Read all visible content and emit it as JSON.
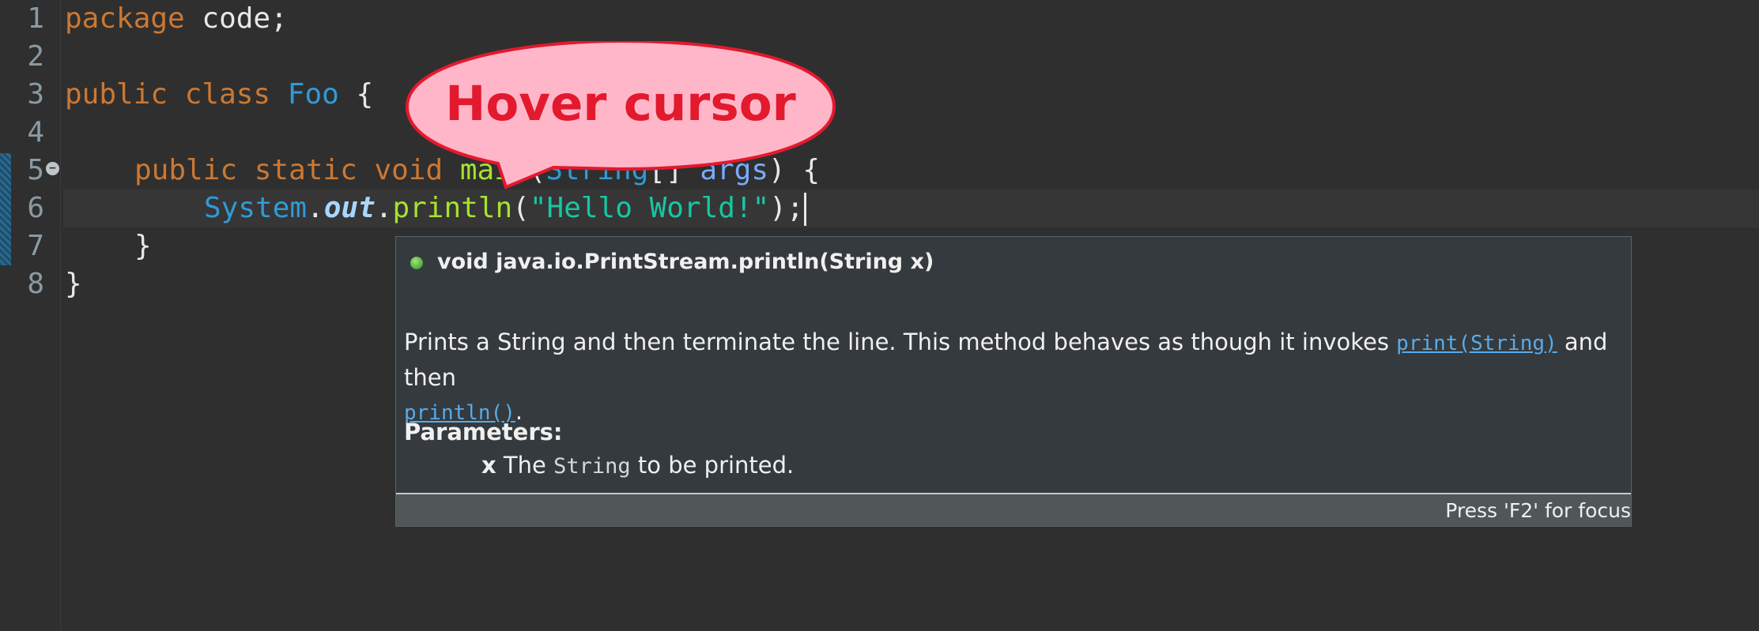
{
  "editor": {
    "line_numbers": [
      "1",
      "2",
      "3",
      "4",
      "5",
      "6",
      "7",
      "8"
    ],
    "lines": {
      "l1": {
        "kw": "package",
        "rest": " code;"
      },
      "l3": {
        "kw1": "public",
        "kw2": "class",
        "name": "Foo",
        "rest": " {"
      },
      "l5": {
        "kw1": "public",
        "kw2": "static",
        "kw3": "void",
        "method": "main",
        "paren": "(",
        "type": "String",
        "brackets": "[] ",
        "param": "args",
        "rest": ") {"
      },
      "l6": {
        "cls": "System",
        "dot1": ".",
        "field": "out",
        "dot2": ".",
        "method": "println",
        "paren_open": "(",
        "str": "\"Hello World!\"",
        "paren_close": ");"
      },
      "l7": {
        "text": "}"
      },
      "l8": {
        "text": "}"
      }
    },
    "colors": {
      "keyword": "#cc7832",
      "class": "#2f9bd6",
      "string": "#17c6a3",
      "method": "#a6e22e"
    }
  },
  "hover": {
    "signature": "void java.io.PrintStream.println(String x)",
    "desc_before": "Prints a String and then terminate the line. This method behaves as though it invokes ",
    "link1": "print(String)",
    "desc_middle": " and then ",
    "link2": "println()",
    "desc_end": ".",
    "params_label": "Parameters:",
    "param_name": "x",
    "param_text_before": " The ",
    "param_type": "String",
    "param_text_after": " to be printed.",
    "status": "Press 'F2' for focus"
  },
  "callout": {
    "label": "Hover cursor",
    "fill": "#ffb6c8",
    "stroke": "#e3192e"
  }
}
